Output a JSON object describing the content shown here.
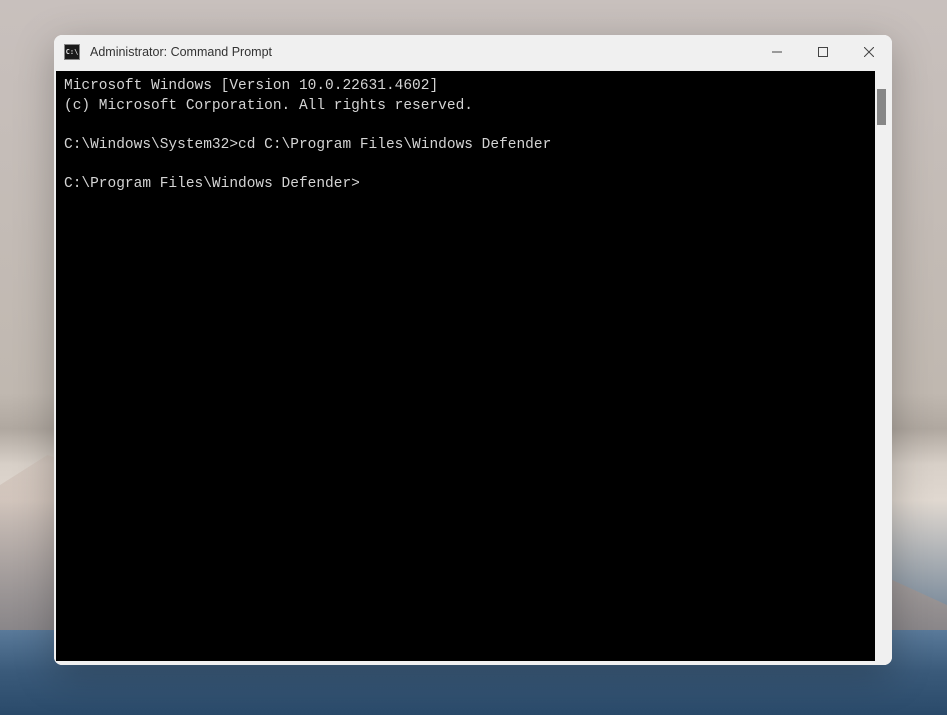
{
  "window": {
    "title": "Administrator: Command Prompt",
    "app_icon_label": "C:\\"
  },
  "terminal": {
    "lines": [
      "Microsoft Windows [Version 10.0.22631.4602]",
      "(c) Microsoft Corporation. All rights reserved.",
      "",
      "C:\\Windows\\System32>cd C:\\Program Files\\Windows Defender",
      "",
      "C:\\Program Files\\Windows Defender>"
    ]
  }
}
